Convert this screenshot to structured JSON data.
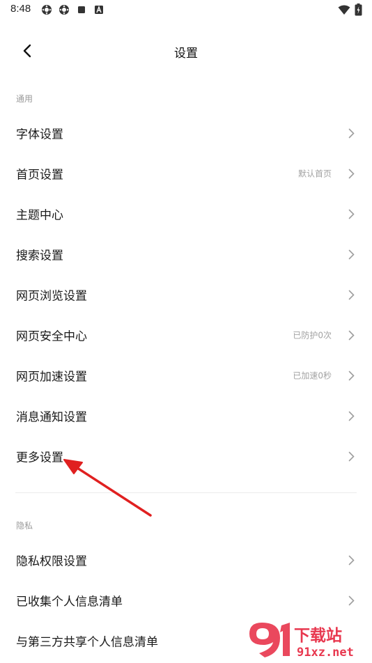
{
  "status_bar": {
    "time": "8:48",
    "icons": [
      "gear-icon",
      "gear-icon",
      "stop-icon",
      "a-icon"
    ],
    "right_icons": [
      "wifi-icon",
      "battery-icon"
    ]
  },
  "header": {
    "title": "设置",
    "back_icon": "back-arrow-icon"
  },
  "sections": [
    {
      "label": "通用",
      "items": [
        {
          "label": "字体设置",
          "value": ""
        },
        {
          "label": "首页设置",
          "value": "默认首页"
        },
        {
          "label": "主题中心",
          "value": ""
        },
        {
          "label": "搜索设置",
          "value": ""
        },
        {
          "label": "网页浏览设置",
          "value": ""
        },
        {
          "label": "网页安全中心",
          "value": "已防护0次"
        },
        {
          "label": "网页加速设置",
          "value": "已加速0秒"
        },
        {
          "label": "消息通知设置",
          "value": ""
        },
        {
          "label": "更多设置",
          "value": ""
        }
      ]
    },
    {
      "label": "隐私",
      "items": [
        {
          "label": "隐私权限设置",
          "value": ""
        },
        {
          "label": "已收集个人信息清单",
          "value": ""
        },
        {
          "label": "与第三方共享个人信息清单",
          "value": ""
        }
      ]
    }
  ],
  "watermark": {
    "text_top": "下载站",
    "text_bottom": "91xz.net"
  },
  "colors": {
    "annotation_arrow": "#e02020",
    "label_text": "#1a1a1a",
    "muted_text": "#9a9a9a",
    "chevron": "#9e9e9e"
  }
}
